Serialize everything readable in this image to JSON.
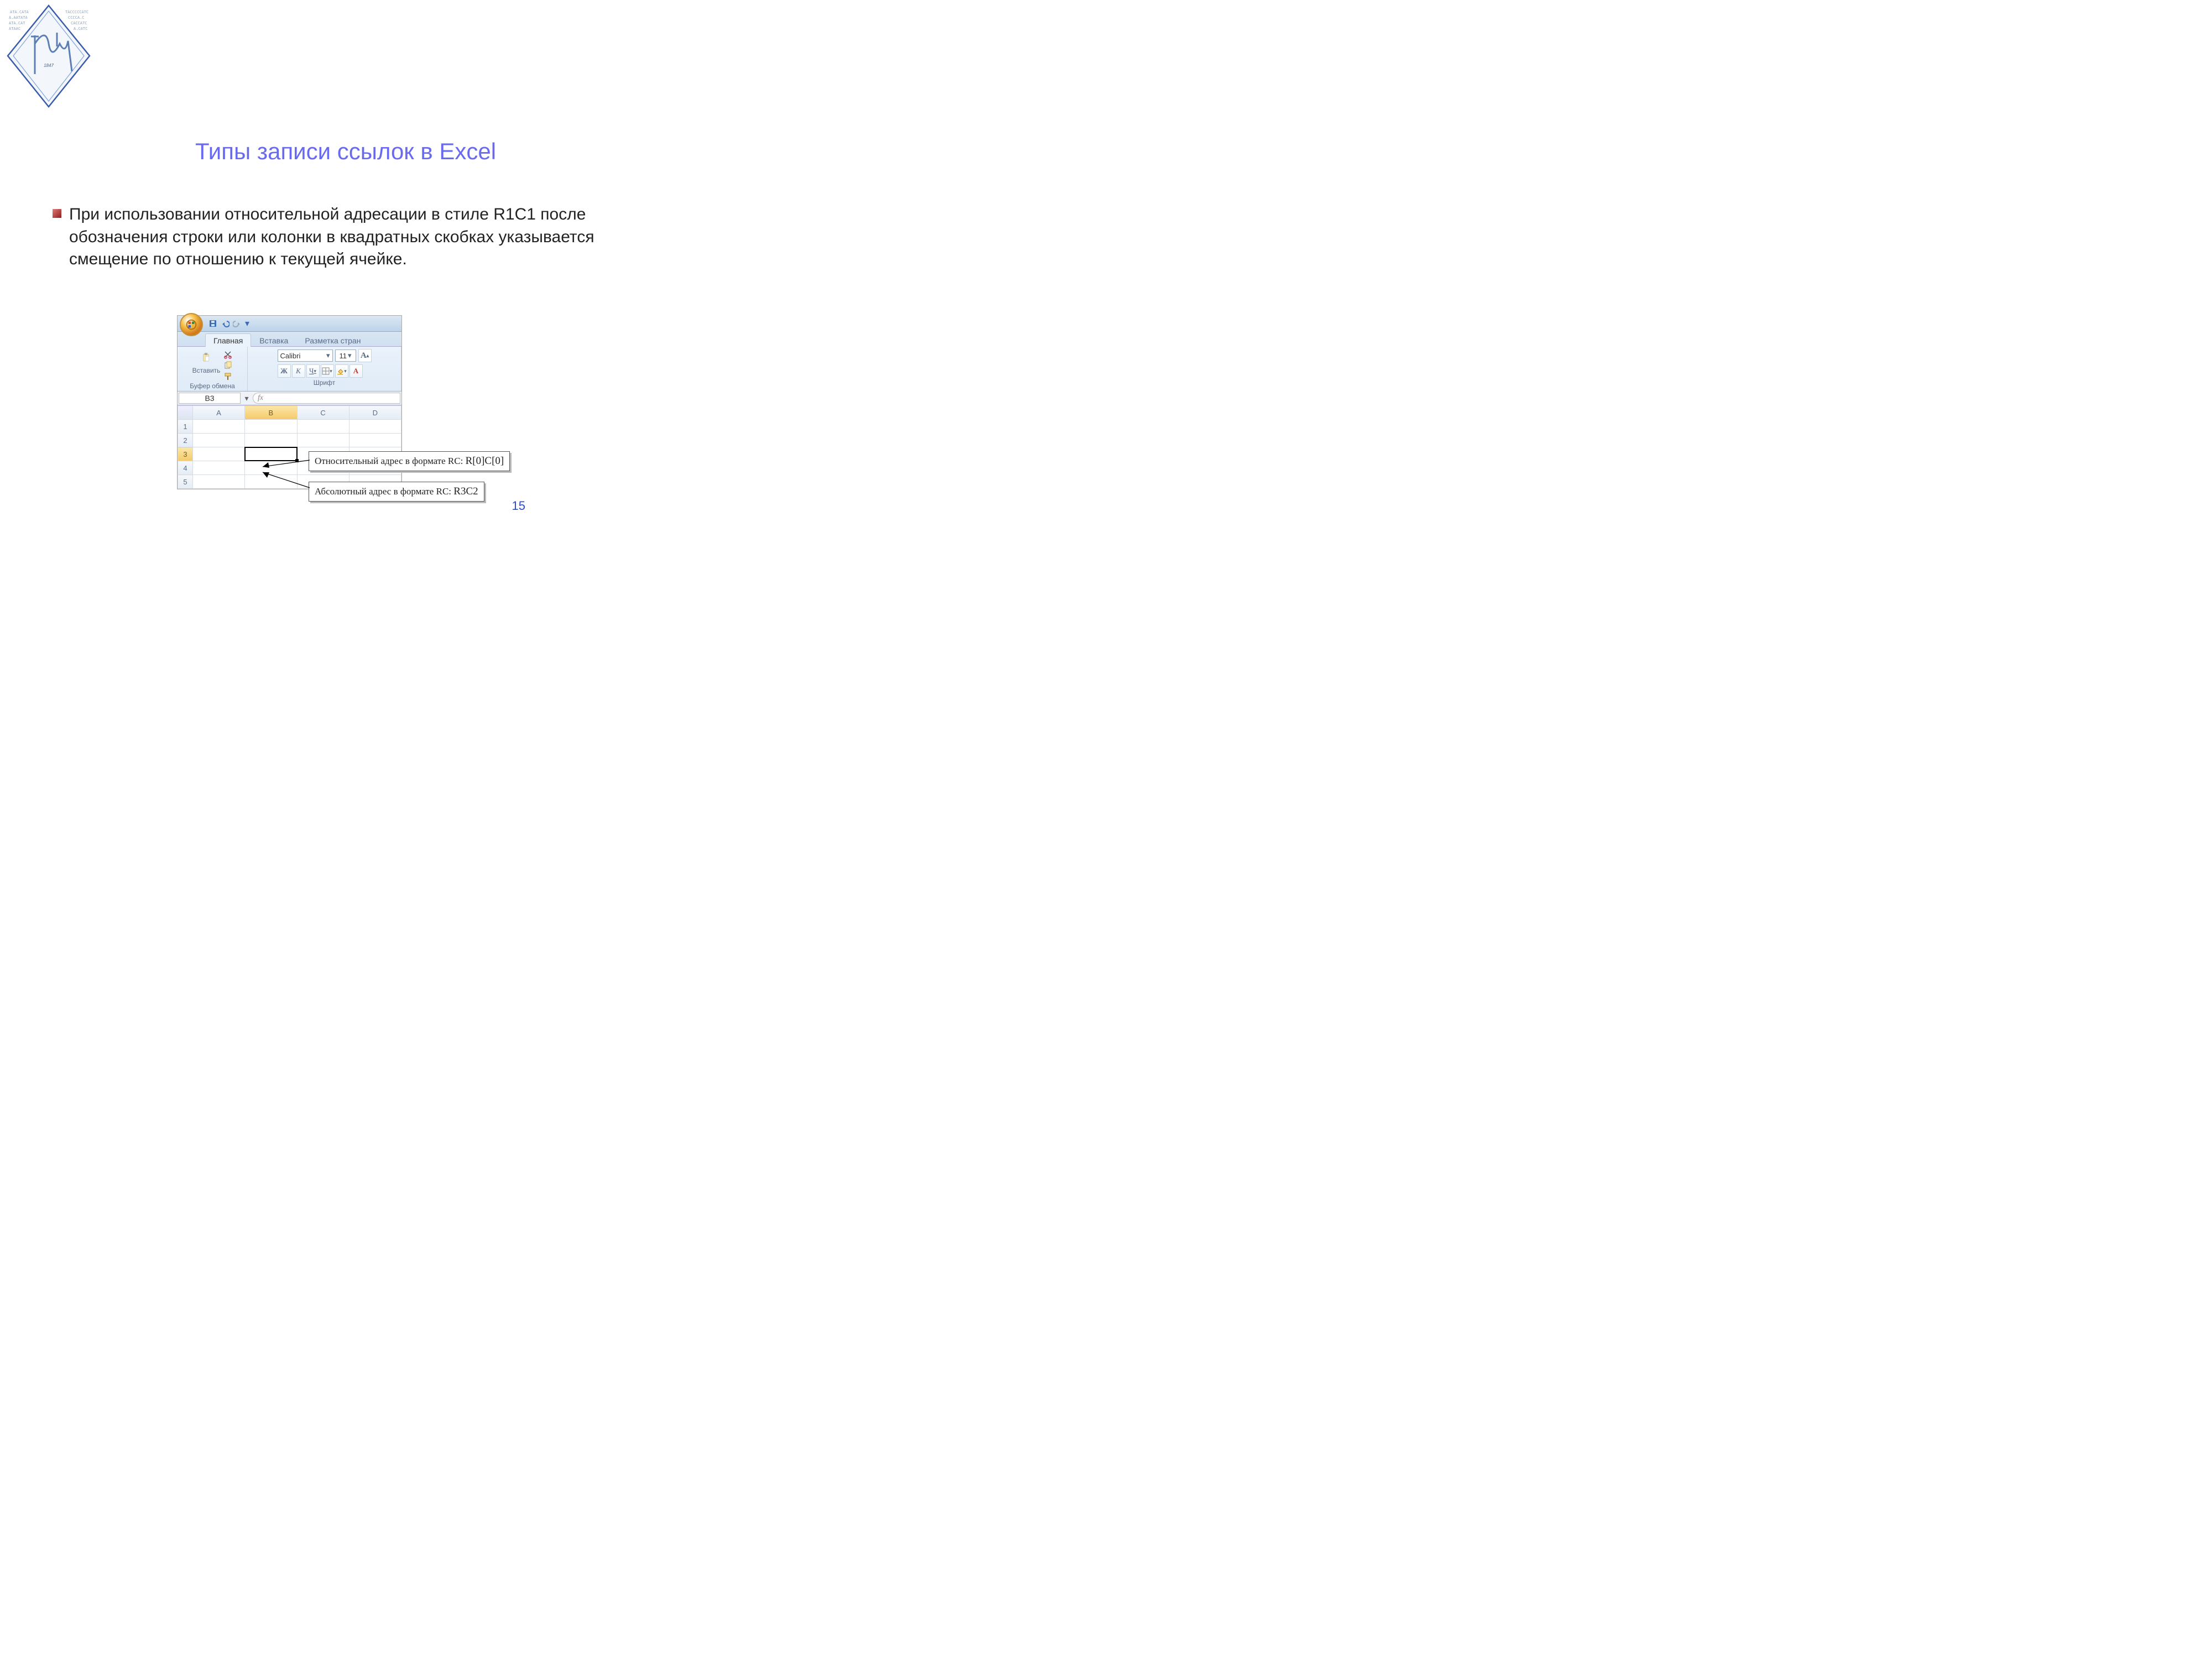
{
  "slide": {
    "title": "Типы записи ссылок в Excel",
    "bullet_text": "При использовании относительной адресации в стиле R1C1 после обозначения строки или колонки в квадратных скобках указывается смещение по отношению к текущей ячейке.",
    "page_number": "15"
  },
  "excel": {
    "tabs": {
      "main": "Главная",
      "insert": "Вставка",
      "layout": "Разметка стран"
    },
    "clipboard": {
      "paste_label": "Вставить",
      "group_label": "Буфер обмена"
    },
    "font": {
      "name": "Calibri",
      "size": "11",
      "bold": "Ж",
      "italic": "К",
      "underline": "Ч",
      "group_label": "Шрифт",
      "a_big": "A"
    },
    "fx_label": "fx",
    "namebox": "B3",
    "columns": [
      "A",
      "B",
      "C",
      "D"
    ],
    "rows": [
      "1",
      "2",
      "3",
      "4",
      "5"
    ]
  },
  "callouts": {
    "relative_prefix": "Относительный адрес в формате RC: ",
    "relative_value": "R[0]C[0]",
    "absolute_prefix": "Абсолютный адрес в формате RC: ",
    "absolute_value": "R3C2"
  }
}
